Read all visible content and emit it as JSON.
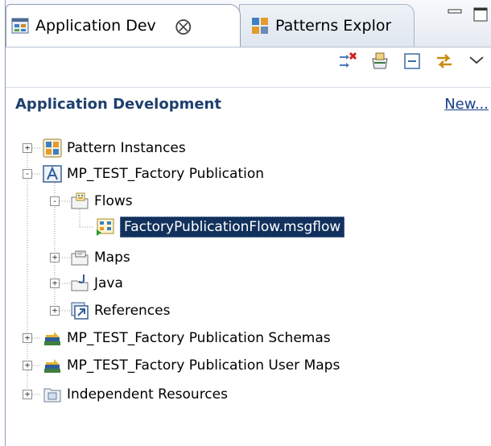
{
  "tabs": [
    {
      "label": "Application Dev",
      "active": true,
      "close": "⨂"
    },
    {
      "label": "Patterns Explor",
      "active": false
    }
  ],
  "section": {
    "title": "Application Development",
    "link": "New..."
  },
  "tree": [
    {
      "label": "Pattern Instances",
      "icon": "pattern-instances-icon",
      "toggle": "+"
    },
    {
      "label": "MP_TEST_Factory Publication",
      "icon": "application-icon",
      "toggle": "-"
    },
    {
      "label": "Flows",
      "icon": "flows-folder-icon",
      "toggle": "-"
    },
    {
      "label": "FactoryPublicationFlow.msgflow",
      "icon": "message-flow-icon",
      "selected": true
    },
    {
      "label": "Maps",
      "icon": "maps-folder-icon",
      "toggle": "+"
    },
    {
      "label": "Java",
      "icon": "java-folder-icon",
      "toggle": "+"
    },
    {
      "label": "References",
      "icon": "references-icon",
      "toggle": "+"
    },
    {
      "label": "MP_TEST_Factory Publication Schemas",
      "icon": "library-icon",
      "toggle": "+"
    },
    {
      "label": "MP_TEST_Factory Publication User Maps",
      "icon": "library-icon",
      "toggle": "+"
    },
    {
      "label": "Independent Resources",
      "icon": "independent-resources-icon",
      "toggle": "+"
    }
  ],
  "colors": {
    "selection": "#12315c",
    "section_title": "#1e3f6e",
    "link": "#1a3e8c"
  }
}
